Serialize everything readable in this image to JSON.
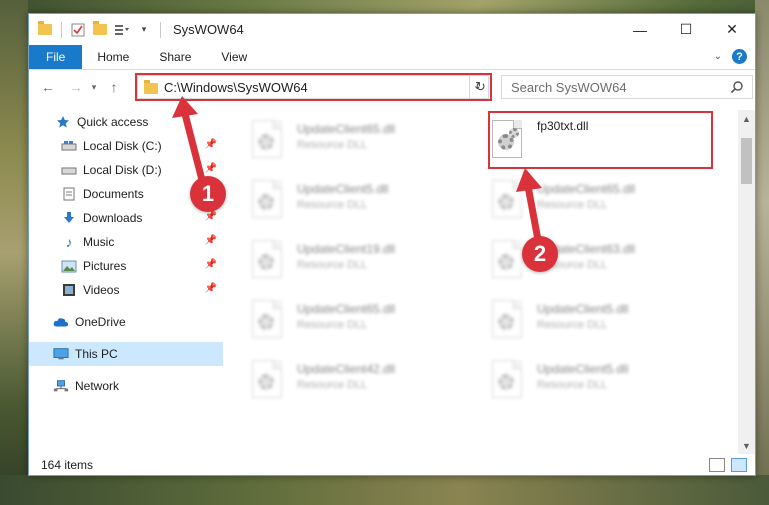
{
  "window": {
    "title": "SysWOW64",
    "controls": {
      "minimize": "—",
      "maximize": "☐",
      "close": "✕"
    }
  },
  "ribbon": {
    "tabs": [
      "File",
      "Home",
      "Share",
      "View"
    ]
  },
  "address": {
    "path": "C:\\Windows\\SysWOW64",
    "search_placeholder": "Search SysWOW64"
  },
  "nav": {
    "items": [
      {
        "label": "Quick access",
        "icon": "star-icon",
        "pinned": false
      },
      {
        "label": "Local Disk (C:)",
        "icon": "drive-icon",
        "pinned": true
      },
      {
        "label": "Local Disk (D:)",
        "icon": "drive-icon",
        "pinned": true
      },
      {
        "label": "Documents",
        "icon": "documents-icon",
        "pinned": true
      },
      {
        "label": "Downloads",
        "icon": "download-icon",
        "pinned": true
      },
      {
        "label": "Music",
        "icon": "music-icon",
        "pinned": true
      },
      {
        "label": "Pictures",
        "icon": "pictures-icon",
        "pinned": true
      },
      {
        "label": "Videos",
        "icon": "videos-icon",
        "pinned": true
      },
      {
        "label": "OneDrive",
        "icon": "cloud-icon",
        "pinned": false
      },
      {
        "label": "This PC",
        "icon": "computer-icon",
        "pinned": false,
        "selected": true
      },
      {
        "label": "Network",
        "icon": "network-icon",
        "pinned": false
      }
    ]
  },
  "files": {
    "col1": [
      {
        "name": "UpdateClient65.dll",
        "type": "Resource DLL"
      },
      {
        "name": "UpdateClient5.dll",
        "type": "Resource DLL"
      },
      {
        "name": "UpdateClient19.dll",
        "type": "Resource DLL"
      },
      {
        "name": "UpdateClient65.dll",
        "type": "Resource DLL"
      },
      {
        "name": "UpdateClient42.dll",
        "type": "Resource DLL"
      }
    ],
    "col2": [
      {
        "name": "fp30txt.dll",
        "type": ""
      },
      {
        "name": "UpdateClient65.dll",
        "type": "Resource DLL"
      },
      {
        "name": "UpdateClient63.dll",
        "type": "Resource DLL"
      },
      {
        "name": "UpdateClient5.dll",
        "type": "Resource DLL"
      },
      {
        "name": "UpdateClient5.dll",
        "type": "Resource DLL"
      }
    ]
  },
  "status": {
    "item_count": "164 items"
  },
  "annotations": {
    "marker1": "1",
    "marker2": "2",
    "accent": "#d9323b"
  }
}
